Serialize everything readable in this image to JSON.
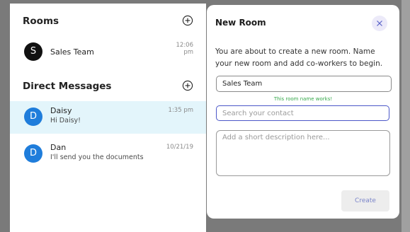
{
  "rooms": {
    "title": "Rooms",
    "items": [
      {
        "initial": "S",
        "name": "Sales Team",
        "time_line1": "12:06",
        "time_line2": "pm"
      }
    ]
  },
  "direct_messages": {
    "title": "Direct Messages",
    "items": [
      {
        "initial": "D",
        "name": "Daisy",
        "preview": "Hi Daisy!",
        "time": "1:35 pm",
        "selected": true
      },
      {
        "initial": "D",
        "name": "Dan",
        "preview": "I'll send you the documents",
        "time": "10/21/19",
        "selected": false
      }
    ]
  },
  "modal": {
    "title": "New Room",
    "description": "You are about to create a new room. Name your new room and add co-workers to begin.",
    "room_name_value": "Sales Team",
    "room_name_hint": "This room name works!",
    "search_placeholder": "Search your contact",
    "description_placeholder": "Add a short description here...",
    "create_label": "Create"
  },
  "colors": {
    "selected_row": "#e3f5fb",
    "avatar_blue": "#1f7ddb",
    "avatar_black": "#111111",
    "hint_green": "#35a84a",
    "focus_border": "#4b57c8",
    "close_button_bg": "#eceaf9"
  },
  "icons": {
    "add": "plus-circle-icon",
    "close": "close-icon"
  }
}
